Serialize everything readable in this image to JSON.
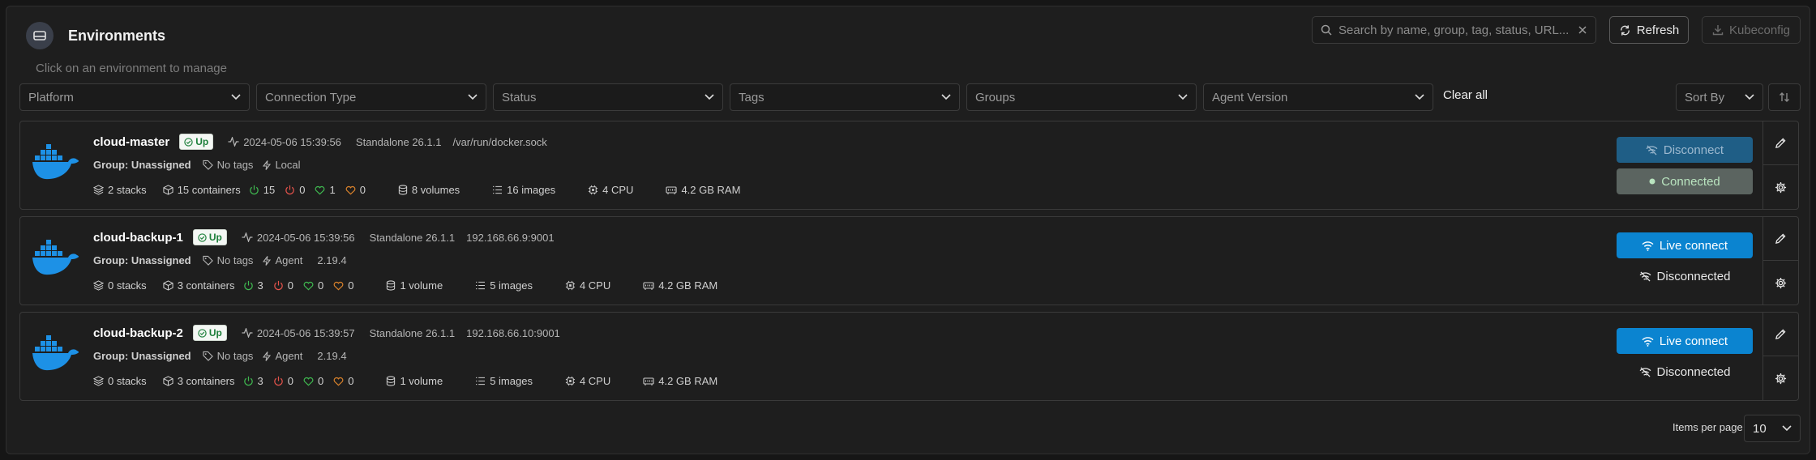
{
  "header": {
    "title": "Environments",
    "subtitle": "Click on an environment to manage"
  },
  "search": {
    "placeholder": "Search by name, group, tag, status, URL..."
  },
  "toolbar": {
    "refresh_label": "Refresh",
    "kubeconfig_label": "Kubeconfig"
  },
  "filters": [
    {
      "label": "Platform"
    },
    {
      "label": "Connection Type"
    },
    {
      "label": "Status"
    },
    {
      "label": "Tags"
    },
    {
      "label": "Groups"
    },
    {
      "label": "Agent Version"
    }
  ],
  "clear_all_label": "Clear all",
  "sort": {
    "label": "Sort By"
  },
  "environments": [
    {
      "name": "cloud-master",
      "status": "Up",
      "timestamp": "2024-05-06 15:39:56",
      "type": "Standalone 26.1.1",
      "url": "/var/run/docker.sock",
      "group": "Group: Unassigned",
      "tags": "No tags",
      "connection": "Local",
      "agent_version": "",
      "stacks": "2 stacks",
      "containers": "15 containers",
      "running": "15",
      "stopped": "0",
      "healthy": "1",
      "unhealthy": "0",
      "volumes": "8 volumes",
      "images": "16 images",
      "cpu": "4 CPU",
      "ram": "4.2 GB RAM",
      "primary_action": "Disconnect",
      "secondary_action": "Connected"
    },
    {
      "name": "cloud-backup-1",
      "status": "Up",
      "timestamp": "2024-05-06 15:39:56",
      "type": "Standalone 26.1.1",
      "url": "192.168.66.9:9001",
      "group": "Group: Unassigned",
      "tags": "No tags",
      "connection": "Agent",
      "agent_version": "2.19.4",
      "stacks": "0 stacks",
      "containers": "3 containers",
      "running": "3",
      "stopped": "0",
      "healthy": "0",
      "unhealthy": "0",
      "volumes": "1 volume",
      "images": "5 images",
      "cpu": "4 CPU",
      "ram": "4.2 GB RAM",
      "primary_action": "Live connect",
      "secondary_action": "Disconnected"
    },
    {
      "name": "cloud-backup-2",
      "status": "Up",
      "timestamp": "2024-05-06 15:39:57",
      "type": "Standalone 26.1.1",
      "url": "192.168.66.10:9001",
      "group": "Group: Unassigned",
      "tags": "No tags",
      "connection": "Agent",
      "agent_version": "2.19.4",
      "stacks": "0 stacks",
      "containers": "3 containers",
      "running": "3",
      "stopped": "0",
      "healthy": "0",
      "unhealthy": "0",
      "volumes": "1 volume",
      "images": "5 images",
      "cpu": "4 CPU",
      "ram": "4.2 GB RAM",
      "primary_action": "Live connect",
      "secondary_action": "Disconnected"
    }
  ],
  "pagination": {
    "items_per_page_label": "Items per page",
    "items_per_page_value": "10"
  },
  "colors": {
    "accent": "#0b84d0",
    "up_badge": "#1c7f3a",
    "running": "#3fb950",
    "stopped": "#e5534b",
    "unhealthy": "#d9822b"
  }
}
